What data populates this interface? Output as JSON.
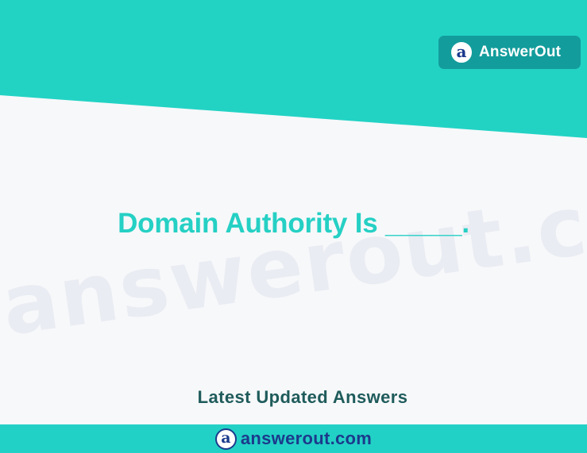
{
  "header": {
    "brand_name": "AnswerOut",
    "logo_glyph": "a",
    "logo_icon": "answerout-logo-icon",
    "band_color": "#22d3c4",
    "badge_color": "#139c9c"
  },
  "watermark": {
    "text": "answerout.com"
  },
  "main": {
    "question": "Domain Authority Is _____.",
    "question_color": "#25d0c4"
  },
  "tagline": {
    "text": "Latest Updated Answers"
  },
  "footer": {
    "logo_glyph": "a",
    "logo_icon": "answerout-logo-icon",
    "url": "answerout.com",
    "background": "#22d1c5"
  }
}
